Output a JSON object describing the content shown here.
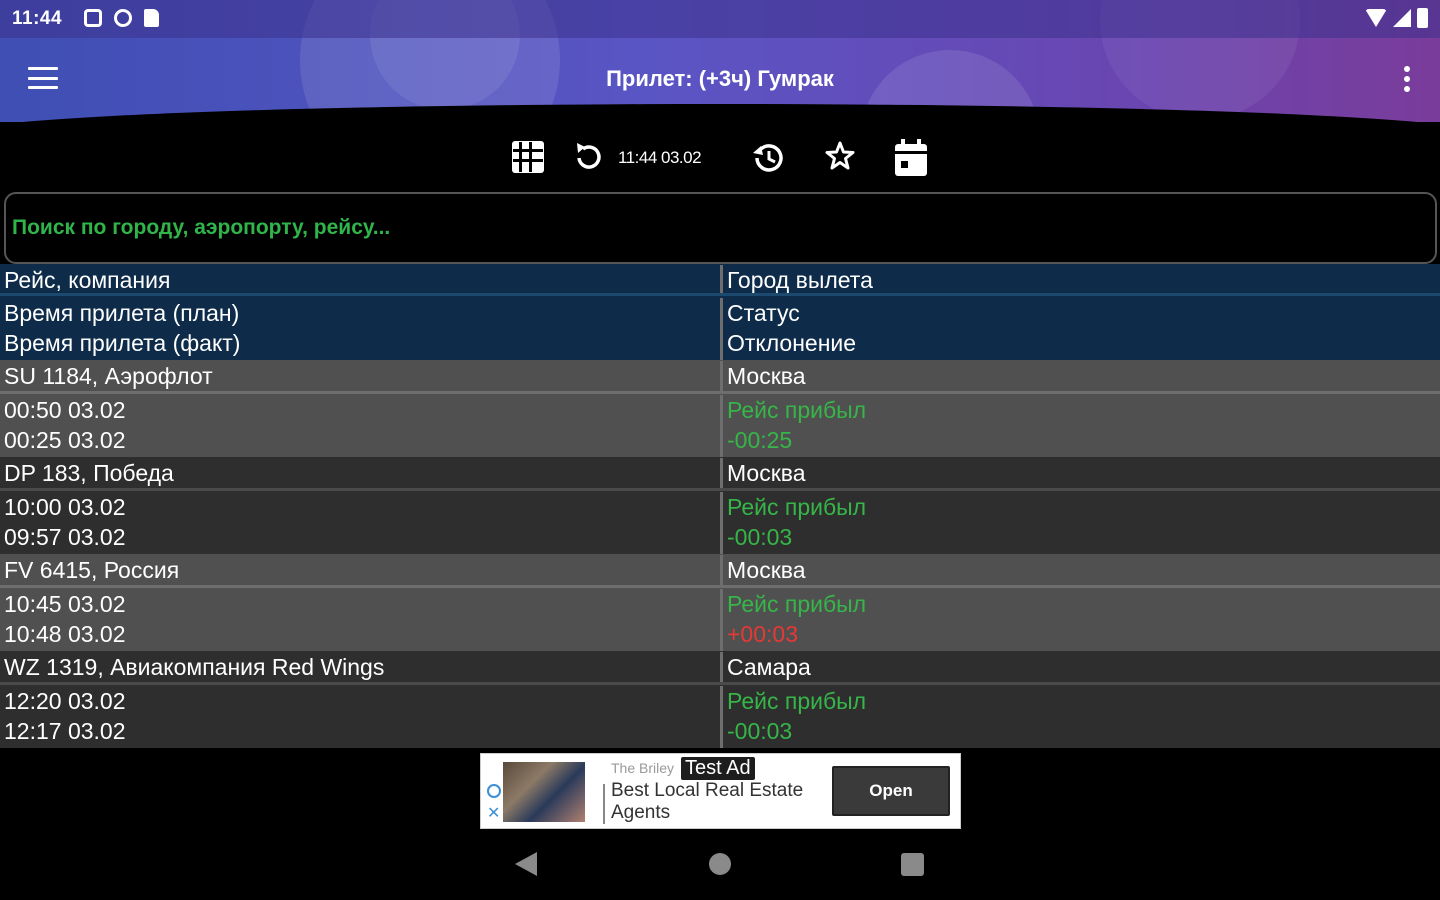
{
  "status_bar": {
    "time": "11:44"
  },
  "header": {
    "title": "Прилет: (+3ч) Гумрак"
  },
  "toolbar": {
    "updated_time": "11:44 03.02"
  },
  "search": {
    "placeholder": "Поиск по городу, аэропорту, рейсу...",
    "value": ""
  },
  "table": {
    "headers": {
      "flight": "Рейс, компания",
      "city": "Город вылета",
      "planned": "Время прилета (план)",
      "status": "Статус",
      "actual": "Время прилета (факт)",
      "deviation": "Отклонение"
    },
    "rows": [
      {
        "flight": "SU 1184, Аэрофлот",
        "city": "Москва",
        "planned": "00:50 03.02",
        "status": "Рейс прибыл",
        "actual": "00:25 03.02",
        "deviation": "-00:25"
      },
      {
        "flight": "DP 183, Победа",
        "city": "Москва",
        "planned": "10:00 03.02",
        "status": "Рейс прибыл",
        "actual": "09:57 03.02",
        "deviation": "-00:03"
      },
      {
        "flight": "FV 6415, Россия",
        "city": "Москва",
        "planned": "10:45 03.02",
        "status": "Рейс прибыл",
        "actual": "10:48 03.02",
        "deviation": "+00:03"
      },
      {
        "flight": "WZ 1319, Авиакомпания Red Wings",
        "city": "Самара",
        "planned": "12:20 03.02",
        "status": "Рейс прибыл",
        "actual": "12:17 03.02",
        "deviation": "-00:03"
      }
    ]
  },
  "ad": {
    "brand": "The Briley",
    "tag": "Test Ad",
    "text": "Best Local Real Estate Agents",
    "button": "Open"
  },
  "colors": {
    "status_green": "#36b548",
    "late_red": "#e53935",
    "header_row_bg": "#0e2c4a",
    "row_light_bg": "#505050",
    "row_dark_bg": "#2e2e2e"
  }
}
